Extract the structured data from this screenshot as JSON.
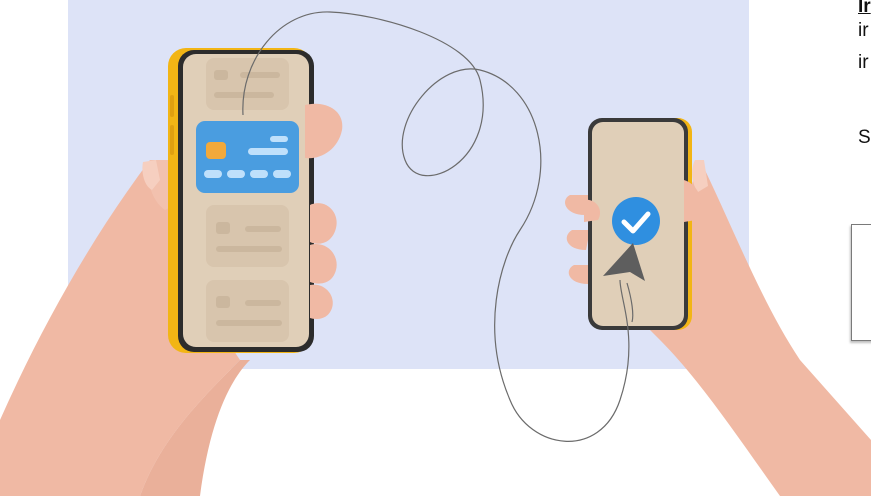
{
  "side_panel": {
    "link_text": "Ir",
    "line1": "ir",
    "line2": "ir",
    "line3": "S"
  },
  "colors": {
    "hero_background": "#dde3f7",
    "phone_frame": "#f2b515",
    "screen": "#e0cfb8",
    "card": "#4a9de0",
    "check_badge": "#2f8fe0",
    "skin": "#f0b9a4"
  },
  "icons": [
    "credit-card-icon",
    "checkmark-icon",
    "cursor-arrow-icon"
  ]
}
